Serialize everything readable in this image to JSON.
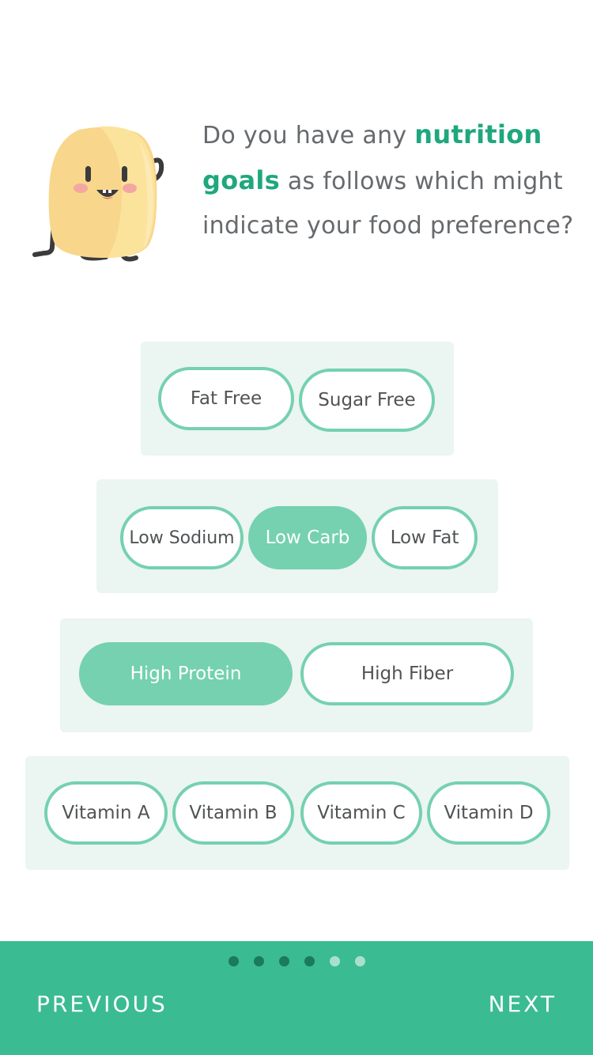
{
  "question": {
    "prefix": "Do you have any ",
    "highlight": "nutrition goals",
    "suffix": " as follows which might indicate your food preference?"
  },
  "rows": [
    {
      "chips": [
        {
          "label": "Fat Free",
          "selected": false
        },
        {
          "label": "Sugar Free",
          "selected": false
        }
      ]
    },
    {
      "chips": [
        {
          "label": "Low Sodium",
          "selected": false
        },
        {
          "label": "Low Carb",
          "selected": true
        },
        {
          "label": "Low Fat",
          "selected": false
        }
      ]
    },
    {
      "chips": [
        {
          "label": "High Protein",
          "selected": true
        },
        {
          "label": "High Fiber",
          "selected": false
        }
      ]
    },
    {
      "chips": [
        {
          "label": "Vitamin A",
          "selected": false
        },
        {
          "label": "Vitamin B",
          "selected": false
        },
        {
          "label": "Vitamin C",
          "selected": false
        },
        {
          "label": "Vitamin D",
          "selected": false
        }
      ]
    }
  ],
  "pagination": {
    "total": 6,
    "current": 4
  },
  "nav": {
    "previous_label": "PREVIOUS",
    "next_label": "NEXT"
  },
  "colors": {
    "accent": "#3bbb91",
    "chip_border": "#75d1b0",
    "highlight_text": "#1fa77d",
    "row_background": "#ebf5f1"
  },
  "mascot": {
    "icon": "potato-mascot-icon"
  }
}
